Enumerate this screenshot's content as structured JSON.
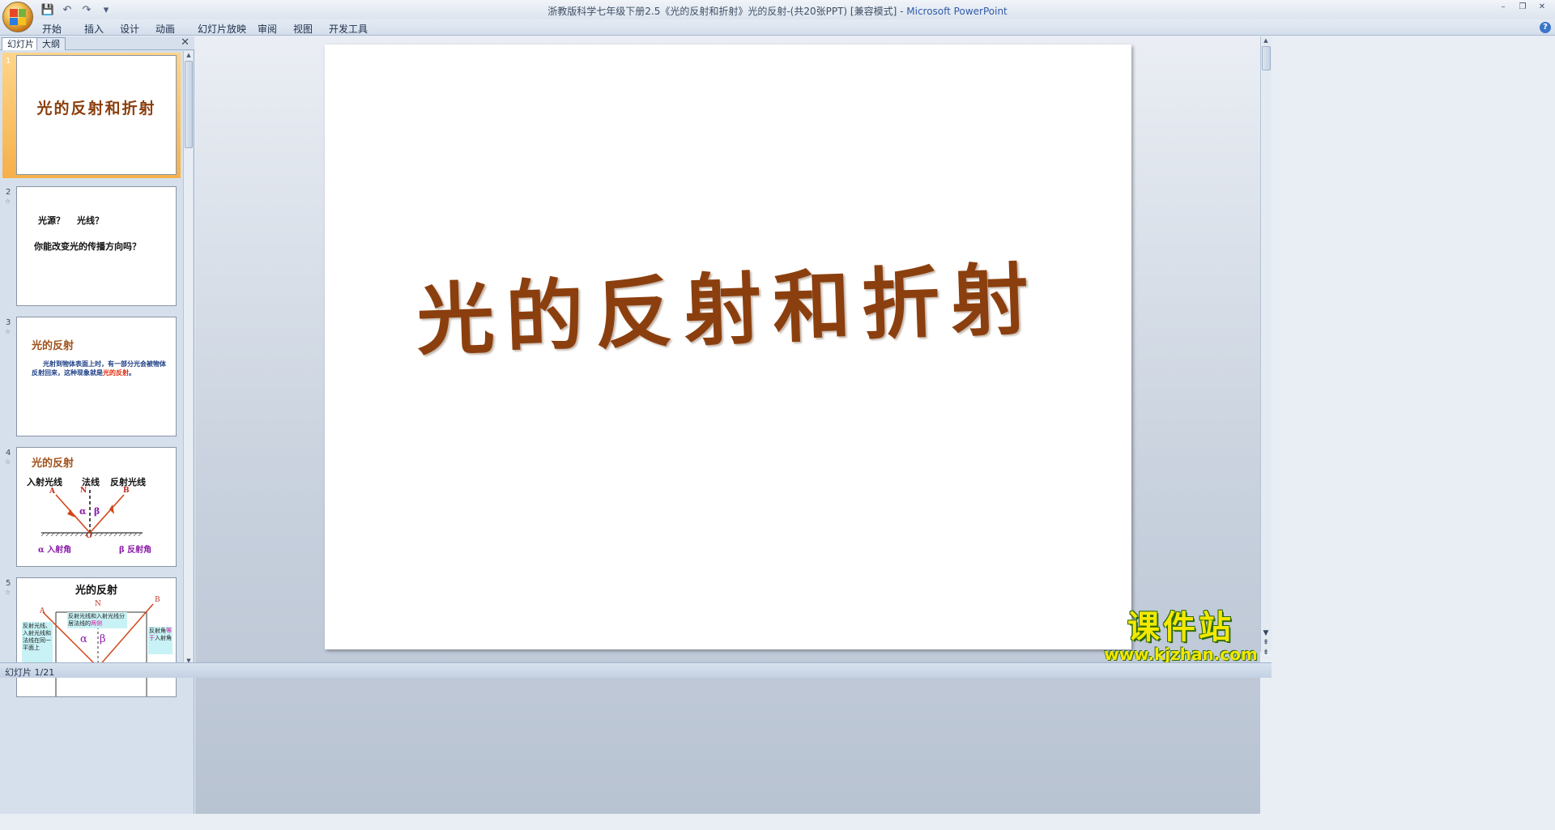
{
  "window": {
    "title": "浙教版科学七年级下册2.5《光的反射和折射》光的反射-(共20张PPT) [兼容模式]",
    "separator": " - ",
    "app_name": "Microsoft PowerPoint"
  },
  "qat": {
    "save": "💾",
    "undo": "↶",
    "redo": "↷",
    "more": "▾"
  },
  "window_controls": {
    "minimize": "–",
    "restore": "❐",
    "close": "✕"
  },
  "ribbon": {
    "tabs": [
      "开始",
      "插入",
      "设计",
      "动画",
      "幻灯片放映",
      "审阅",
      "视图",
      "开发工具"
    ],
    "help": "?"
  },
  "pane": {
    "tabs": {
      "slides": "幻灯片",
      "outline": "大纲"
    },
    "close": "✕"
  },
  "thumbnails": [
    {
      "num": "1",
      "title": "光的反射和折射"
    },
    {
      "num": "2",
      "line1a": "光源？",
      "line1b": "光线？",
      "line2": "你能改变光的传播方向吗？"
    },
    {
      "num": "3",
      "title": "光的反射",
      "body_pre": "光射到物体表面上时，有一部分光会被物体反射回来，这种现象就是",
      "body_hl": "光的反射",
      "body_post": "。"
    },
    {
      "num": "4",
      "title": "光的反射",
      "incident": "入射光线",
      "normal": "法线",
      "reflected": "反射光线",
      "A": "A",
      "N": "N",
      "B": "B",
      "O": "O",
      "alpha": "α",
      "beta": "β",
      "angle_in": "α 入射角",
      "angle_out": "β 反射角"
    },
    {
      "num": "5",
      "title": "光的反射",
      "A": "A",
      "N": "N",
      "B": "B",
      "alpha": "α",
      "beta": "β",
      "box_left": "反射光线、入射光线和法线在同一平面上",
      "box_mid_a": "反射光线和入射光线分居法线的",
      "box_mid_b": "两侧",
      "box_right_a": "反射角",
      "box_right_b": "等于",
      "box_right_c": "入射角"
    }
  ],
  "slide": {
    "title": "光的反射和折射"
  },
  "status": {
    "slide_info": "幻灯片 1/21"
  },
  "watermark": {
    "title": "课件站",
    "url": "www.kjzhan.com"
  },
  "colors": {
    "title_brown": "#8b3f0e",
    "selected_orange": "#f5b04a",
    "watermark_yellow": "#f3e800"
  }
}
